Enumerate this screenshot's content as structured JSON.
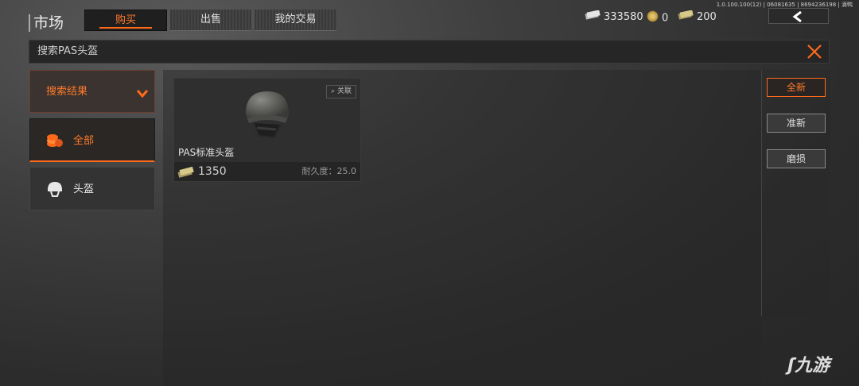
{
  "header": {
    "title": "市场",
    "tabs": [
      {
        "label": "购买",
        "active": true
      },
      {
        "label": "出售",
        "active": false
      },
      {
        "label": "我的交易",
        "active": false
      }
    ],
    "version": "1.0.100.100(12) | 06081635 | 8694236198 | 滴鸭",
    "currencies": [
      {
        "icon": "silver-cash-icon",
        "value": "333580"
      },
      {
        "icon": "gold-coin-icon",
        "value": "0"
      },
      {
        "icon": "cash-stack-icon",
        "value": "200"
      }
    ]
  },
  "search": {
    "value": "搜索PAS头盔"
  },
  "sidebar": {
    "filter_label": "搜索结果",
    "items": [
      {
        "label": "全部",
        "icon": "coins-icon",
        "active": true
      },
      {
        "label": "头盔",
        "icon": "helmet-icon",
        "active": false
      }
    ]
  },
  "items": [
    {
      "name": "PAS标准头盔",
      "price": "1350",
      "durability": "耐久度：25.0",
      "relate_label": "关联"
    }
  ],
  "conditions": [
    {
      "label": "全新",
      "active": true
    },
    {
      "label": "准新",
      "active": false
    },
    {
      "label": "磨损",
      "active": false
    }
  ],
  "watermark": "九游",
  "colors": {
    "accent": "#ff6a1a"
  }
}
